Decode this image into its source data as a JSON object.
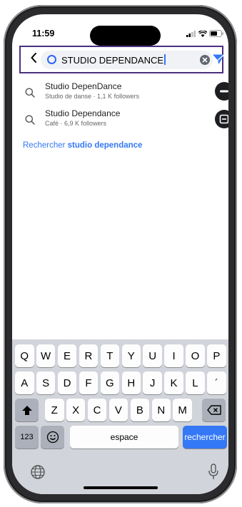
{
  "status_bar": {
    "time": "11:59"
  },
  "search": {
    "query": "STUDIO DEPENDANCE",
    "icons": [
      "back-chevron-icon",
      "search-ring-icon",
      "clear-icon",
      "send-icon"
    ]
  },
  "results": [
    {
      "title": "Studio DepenDance",
      "subtitle": "Studio de danse · 1,1 K followers"
    },
    {
      "title": "Studio Dependance",
      "subtitle": "Café · 6,9 K followers"
    }
  ],
  "search_for": {
    "prefix": "Rechercher ",
    "term": "studio dependance"
  },
  "keyboard": {
    "row1": [
      "Q",
      "W",
      "E",
      "R",
      "T",
      "Y",
      "U",
      "I",
      "O",
      "P"
    ],
    "row2": [
      "A",
      "S",
      "D",
      "F",
      "G",
      "H",
      "J",
      "K",
      "L",
      "´"
    ],
    "row3": [
      "Z",
      "X",
      "C",
      "V",
      "B",
      "N",
      "M"
    ],
    "numbers_label": "123",
    "space_label": "espace",
    "action_label": "rechercher",
    "colors": {
      "background": "#d1d4da",
      "key": "#fdfdfd",
      "action": "#3478f6"
    }
  },
  "colors": {
    "accent": "#3478f6",
    "highlight_frame": "#4b2f7f"
  }
}
